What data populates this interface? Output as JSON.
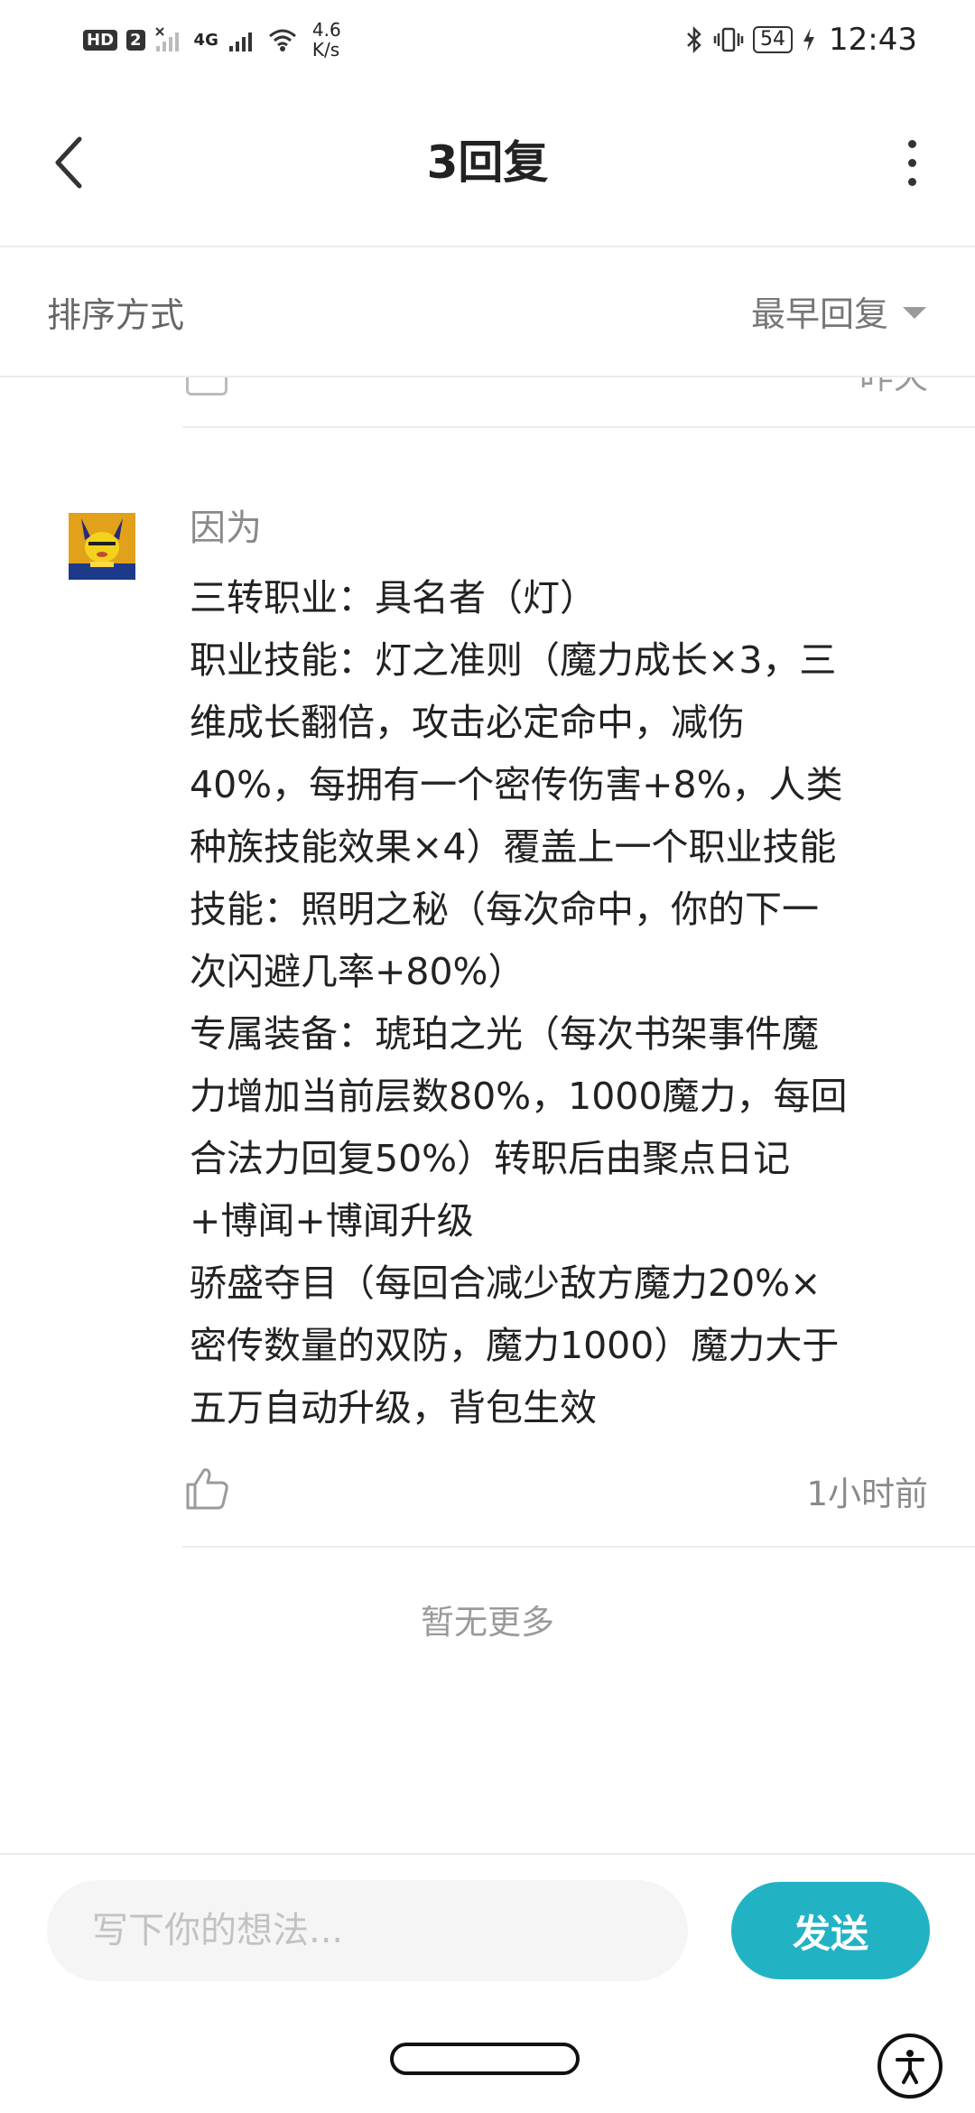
{
  "status_bar": {
    "hd_label": "HD",
    "sim_label": "2",
    "network_4g": "4G",
    "speed_value": "4.6",
    "speed_unit": "K/s",
    "battery": "54",
    "time": "12:43"
  },
  "header": {
    "title": "3回复"
  },
  "sort_bar": {
    "label": "排序方式",
    "selected": "最早回复"
  },
  "previous_reply": {
    "time_partial": "昨天"
  },
  "reply": {
    "author": "因为",
    "lines": [
      "三转职业：具名者（灯）",
      "职业技能：灯之准则（魔力成长×3，三",
      "维成长翻倍，攻击必定命中，减伤",
      "40%，每拥有一个密传伤害+8%，人类",
      "种族技能效果×4）覆盖上一个职业技能",
      "技能：照明之秘（每次命中，你的下一",
      "次闪避几率+80%）",
      "专属装备：琥珀之光（每次书架事件魔",
      "力增加当前层数80%，1000魔力，每回",
      "合法力回复50%）转职后由聚点日记",
      "+博闻+博闻升级",
      "骄盛夺目（每回合减少敌方魔力20%×",
      "密传数量的双防，魔力1000）魔力大于",
      "五万自动升级，背包生效"
    ],
    "time": "1小时前"
  },
  "footer_note": "暂无更多",
  "compose": {
    "placeholder": "写下你的想法...",
    "send_label": "发送"
  },
  "colors": {
    "accent": "#21b3c4",
    "secondary_text": "#8a8a8a",
    "divider": "#ececec"
  }
}
